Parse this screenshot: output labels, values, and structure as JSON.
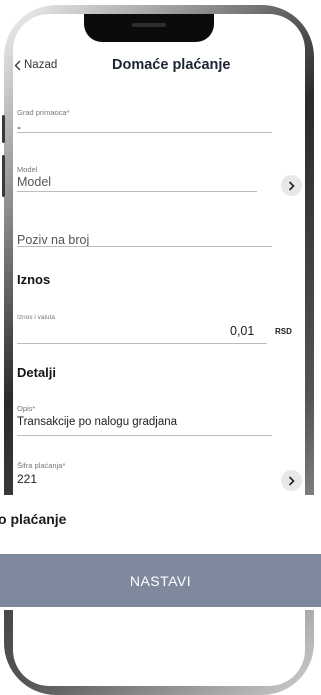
{
  "header": {
    "back_label": "Nazad",
    "title": "Domaće plaćanje"
  },
  "form": {
    "city": {
      "label": "Grad primaoca*",
      "value": "-"
    },
    "model": {
      "label": "Model",
      "placeholder": "Model"
    },
    "reference": {
      "placeholder": "Poziv na broj"
    },
    "amount_section": "Iznos",
    "amount": {
      "label": "Iznos i valuta",
      "value": "0,01",
      "currency": "RSD"
    },
    "details_section": "Detalji",
    "description": {
      "label": "Opis*",
      "value": "Transakcije po nalogu gradjana"
    },
    "payment_code": {
      "label": "Šifra plaćanja*",
      "value": "221"
    }
  },
  "bottom": {
    "label": "o plaćanje",
    "continue_label": "NASTAVI"
  },
  "colors": {
    "button_bg": "#7e899e",
    "title": "#1d2535"
  },
  "icons": [
    "chevron-left-icon",
    "chevron-right-icon"
  ]
}
